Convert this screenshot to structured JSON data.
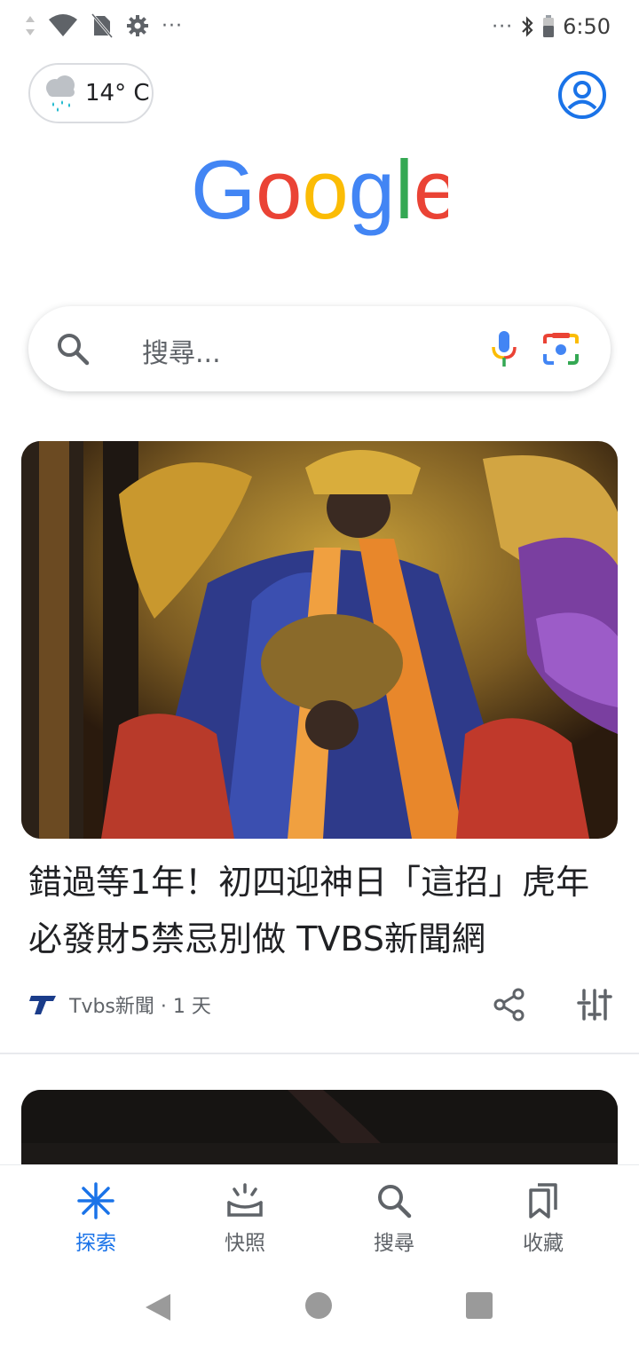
{
  "status_bar": {
    "time": "6:50",
    "left_icons": [
      "data-arrows-icon",
      "wifi-icon",
      "no-sim-icon",
      "settings-gear-icon",
      "more-dots-icon"
    ],
    "right_icons": [
      "more-dots-icon",
      "bluetooth-icon",
      "battery-icon"
    ],
    "dots": "···"
  },
  "weather": {
    "temperature": "14° C",
    "icon": "rain-cloud-icon"
  },
  "logo": {
    "text": "Google",
    "colors": [
      "#4285F4",
      "#EA4335",
      "#FBBC05",
      "#4285F4",
      "#34A853",
      "#EA4335"
    ]
  },
  "search": {
    "placeholder": "搜尋..."
  },
  "feed": {
    "card1": {
      "title": "錯過等1年！初四迎神日「這招」虎年必發財5禁忌別做 TVBS新聞網",
      "source": "Tvbs新聞 · 1 天",
      "source_logo": "T"
    }
  },
  "bottom_nav": {
    "items": [
      {
        "label": "探索",
        "icon": "discover-asterisk-icon",
        "active": true
      },
      {
        "label": "快照",
        "icon": "snapshot-icon",
        "active": false
      },
      {
        "label": "搜尋",
        "icon": "search-icon",
        "active": false
      },
      {
        "label": "收藏",
        "icon": "collections-bookmark-icon",
        "active": false
      }
    ]
  },
  "colors": {
    "accent": "#1a73e8",
    "text_primary": "#202124",
    "text_secondary": "#5f6368"
  }
}
